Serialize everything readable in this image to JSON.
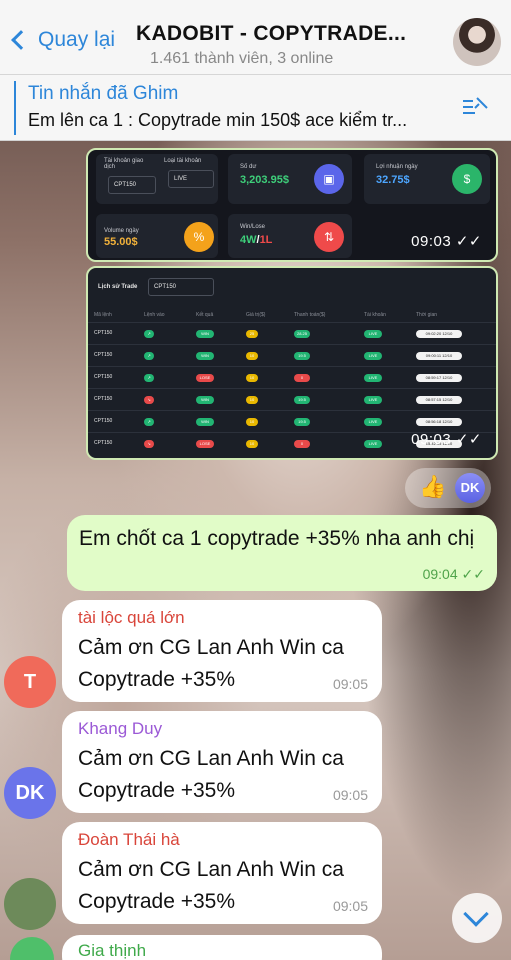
{
  "header": {
    "back_label": "Quay lại",
    "title": "KADOBIT - COPYTRADE...",
    "subtitle": "1.461 thành viên, 3 online"
  },
  "pinned": {
    "title": "Tin nhắn đã Ghim",
    "message": "Em lên ca 1 : Copytrade min 150$ ace kiểm tr..."
  },
  "shot1": {
    "account_label": "Tài khoản giao dịch",
    "account_value": "CPT150",
    "type_label": "Loại tài khoản",
    "type_value": "LIVE",
    "balance_label": "Số dư",
    "balance_value": "3,203.95$",
    "profit_label": "Lợi nhuận ngày",
    "profit_value": "32.75$",
    "volume_label": "Volume ngày",
    "volume_value": "55.00$",
    "winloss_label": "Win/Lose",
    "win_value": "4W",
    "sep": "/",
    "loss_value": "1L",
    "time": "09:03"
  },
  "shot2": {
    "title": "Lịch sử Trade",
    "select": "CPT150",
    "headers": [
      "Mã lệnh",
      "Lệnh vào",
      "Kết quả",
      "Giá trị($)",
      "Thanh toán($)",
      "Tài khoản",
      "Thời gian"
    ],
    "rows": [
      {
        "code": "CPT150",
        "dir": "up",
        "result": "WIN",
        "amount": "25",
        "payout": "28.25",
        "acct": "LIVE",
        "time": "09:02:20 12/10"
      },
      {
        "code": "CPT150",
        "dir": "up",
        "result": "WIN",
        "amount": "10",
        "payout": "19.5",
        "acct": "LIVE",
        "time": "09:00:11 12/10"
      },
      {
        "code": "CPT150",
        "dir": "up",
        "result": "LOSE",
        "amount": "10",
        "payout": "0",
        "acct": "LIVE",
        "time": "08:59:17 12/10"
      },
      {
        "code": "CPT150",
        "dir": "down",
        "result": "WIN",
        "amount": "10",
        "payout": "19.5",
        "acct": "LIVE",
        "time": "08:57:15 12/10"
      },
      {
        "code": "CPT150",
        "dir": "up",
        "result": "WIN",
        "amount": "10",
        "payout": "19.5",
        "acct": "LIVE",
        "time": "08:56:18 12/10"
      },
      {
        "code": "CPT150",
        "dir": "down",
        "result": "LOSE",
        "amount": "10",
        "payout": "0",
        "acct": "LIVE",
        "time": "15:42:15 11/10"
      }
    ],
    "time": "09:03"
  },
  "reaction": {
    "emoji": "👍",
    "avatar": "DK"
  },
  "outgoing": {
    "text": "Em chốt ca 1 copytrade +35% nha anh chị",
    "time": "09:04"
  },
  "messages": [
    {
      "name": "tài lộc quá lớn",
      "name_color": "#d9453a",
      "text": "Cảm ơn CG Lan Anh Win ca Copytrade +35%",
      "time": "09:05",
      "avatar": "T",
      "avatar_color": "#f06a5a"
    },
    {
      "name": "Khang Duy",
      "name_color": "#9b59d6",
      "text": "Cảm ơn CG Lan Anh Win ca Copytrade +35%",
      "time": "09:05",
      "avatar": "DK",
      "avatar_color": "#6a74ea"
    },
    {
      "name": "Đoàn Thái hà",
      "name_color": "#d9453a",
      "text": "Cảm ơn CG Lan Anh Win ca Copytrade +35%",
      "time": "09:05",
      "avatar": "",
      "avatar_color": "#6d8a5a"
    }
  ],
  "partial_name": "Gia thịnh"
}
